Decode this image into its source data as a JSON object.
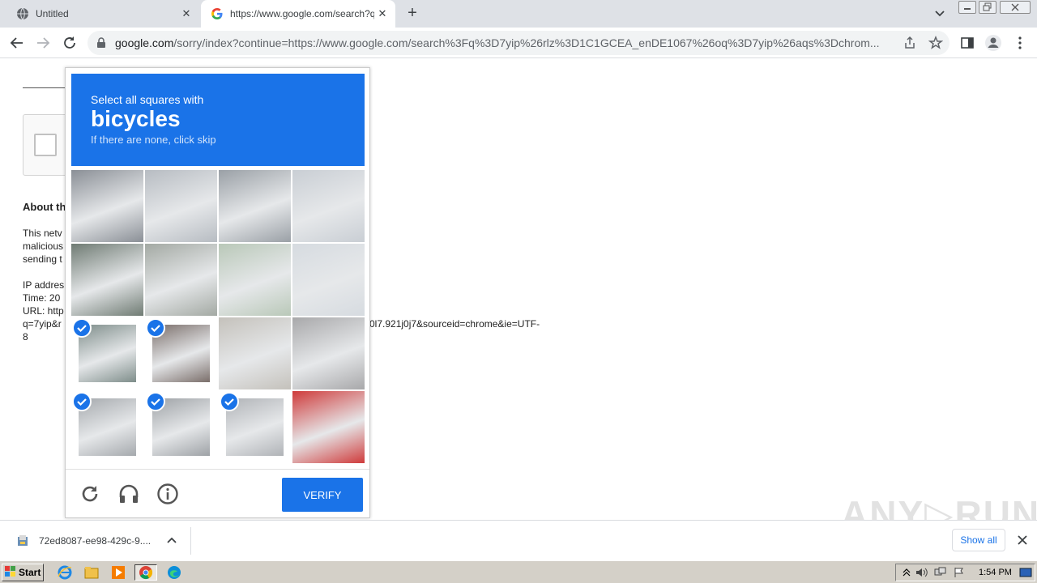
{
  "browser": {
    "tabs": [
      {
        "title": "Untitled"
      },
      {
        "title": "https://www.google.com/search?q="
      }
    ],
    "url_host": "google.com",
    "url_rest": "/sorry/index?continue=https://www.google.com/search%3Fq%3D7yip%26rlz%3D1C1GCEA_enDE1067%26oq%3D7yip%26aqs%3Dchrom..."
  },
  "page": {
    "about_heading": "About th",
    "body_lines": [
      "This netv",
      "malicious",
      "sending t"
    ],
    "ip_line": "IP addres",
    "time_line": "Time: 20",
    "url_line": "URL: http",
    "url_wrap_start": "q=7yip&r",
    "url_wrap_end": "0l7.921j0j7&sourceid=chrome&ie=UTF-",
    "url_last": "8"
  },
  "captcha": {
    "instruction": "Select all squares with",
    "target": "bicycles",
    "hint": "If there are none, click skip",
    "selected_tiles": [
      8,
      9,
      12,
      13,
      14
    ],
    "verify_label": "VERIFY"
  },
  "download": {
    "filename": "72ed8087-ee98-429c-9....",
    "show_all": "Show all"
  },
  "watermark": "ANY▷RUN",
  "taskbar": {
    "start_label": "Start",
    "clock": "1:54 PM"
  },
  "icons": [
    "globe-icon",
    "google-g-icon",
    "close-icon",
    "plus-icon",
    "chevron-down-icon",
    "back-icon",
    "forward-icon",
    "reload-icon",
    "lock-icon",
    "share-icon",
    "star-icon",
    "side-panel-icon",
    "profile-icon",
    "menu-icon",
    "refresh-icon",
    "headphones-icon",
    "info-icon",
    "checkmark-icon",
    "file-icon",
    "windows-flag-icon",
    "ie-icon",
    "folder-icon",
    "media-icon",
    "chrome-icon",
    "edge-icon"
  ]
}
